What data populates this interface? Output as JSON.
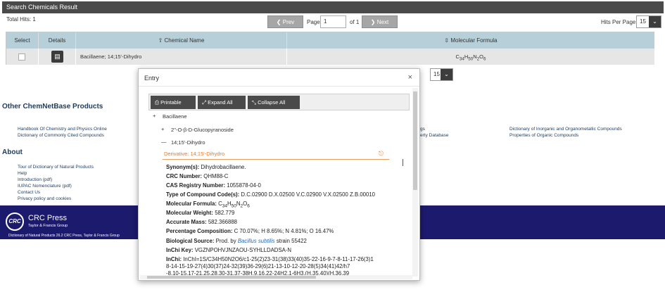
{
  "header": {
    "title": "Search Chemicals Result"
  },
  "results": {
    "total_hits": "Total Hits: 1",
    "prev_label": "Prev",
    "next_label": "Next",
    "page_label": "Page",
    "page_value": "1",
    "of_label": "of 1",
    "hits_per_page_label": "Hits Per Page",
    "hits_per_page_value": "15",
    "prev_icon": "chevron-left-icon",
    "next_icon": "chevron-right-icon"
  },
  "table": {
    "headers": {
      "select": "Select",
      "details": "Details",
      "name": "Chemical Name",
      "formula": "Molecular Formula"
    },
    "row": {
      "name": "Bacillaene; 14;15'-Dihydro",
      "formula": "C34H50N2O6"
    }
  },
  "background_select": {
    "value": "15"
  },
  "products": {
    "heading": "Other ChemNetBase Products",
    "links": [
      "Handbook Of Chemistry and Physics Online",
      "Dictionary of Commonly Cited Compounds"
    ],
    "links_mid": [
      "gs",
      "erty Database"
    ],
    "links_right": [
      "Dictionary of Inorganic and Organometallic Compounds",
      "Properties of Organic Compounds"
    ]
  },
  "about": {
    "heading": "About",
    "links": [
      "Tour of Dictionary of Natural Products",
      "Help",
      "Introduction (pdf)",
      "IUPAC Nomenclature (pdf)",
      "Contact Us",
      "Privacy policy and cookies"
    ]
  },
  "footer": {
    "logo_text": "CRC",
    "brand": "CRC Press",
    "sub": "Taylor & Francis Group",
    "copyright": "Dictionary of Natural Products 26.2   CRC Press, Taylor & Francis Group"
  },
  "modal": {
    "title": "Entry",
    "close": "×",
    "toolbar": {
      "printable": "Printable",
      "expand": "Expand All",
      "collapse": "Collapse All"
    },
    "tree": {
      "root": "Bacillaene",
      "child1": "2''-O-β-D-Glucopyranoside",
      "child2": "14;15'-Dihydro",
      "plus": "+",
      "minus": "—"
    },
    "derivative": "Derivative: 14;15'-Dihydro",
    "props": [
      {
        "label": "Synonym(s):",
        "value": "Dihydrobacillaene."
      },
      {
        "label": "CRC Number:",
        "value": "QHM88-C"
      },
      {
        "label": "CAS Registry Number:",
        "value": "1055878-04-0"
      },
      {
        "label": "Type of Compound Code(s):",
        "value": "D.C.02900  D.X.02500  V.C.02900  V.X.02500  Z.B.00010"
      },
      {
        "label": "Molecular Formula:",
        "value": "C34H50N2O6"
      },
      {
        "label": "Molecular Weight:",
        "value": "582.779"
      },
      {
        "label": "Accurate Mass:",
        "value": "582.366888"
      },
      {
        "label": "Percentage Composition:",
        "value": "C 70.07%; H 8.65%; N 4.81%; O 16.47%"
      },
      {
        "label": "Biological Source:",
        "value_pre": "Prod. by",
        "value_species": "Bacillus subtilis",
        "value_post": "strain 55422"
      },
      {
        "label": "InChi Key:",
        "value": "VGZNPOHVJNZAOU-SYHLLDADSA-N"
      },
      {
        "label": "InChi:",
        "value": "InChI=1S/C34H50N2O6/c1-25(2)23-31(38)33(40)35-22-16-9-7-8-11-17-26(3)1"
      }
    ],
    "inchi_line2": "8-14-15-19-27(4)30(37)24-32(39)36-29(6)21-13-10-12-20-28(5)34(41)42/h7",
    "inchi_line3": "-8,10-15,17-21,25,28,30-31,37-38H,9,16,22-24H2,1-6H3,(H,35,40)(H,36,39"
  },
  "colors": {
    "header_bg": "#4a4a4a",
    "table_header": "#b6cfd9",
    "footer_bg": "#1c1a6c",
    "accent_orange": "#e8792a",
    "link_blue": "#1d3b5c"
  }
}
